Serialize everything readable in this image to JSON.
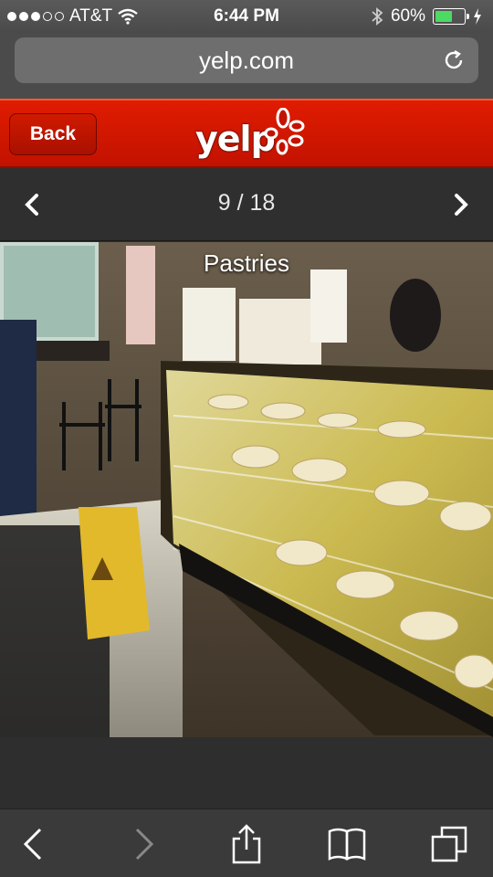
{
  "status_bar": {
    "carrier": "AT&T",
    "time": "6:44 PM",
    "battery": "60%",
    "battery_level": 0.6,
    "signal_bars": 3,
    "signal_total": 5
  },
  "browser": {
    "url": "yelp.com"
  },
  "header": {
    "back_label": "Back",
    "logo_text": "yelp"
  },
  "pager": {
    "counter": "9 / 18"
  },
  "photo": {
    "caption": "Pastries"
  },
  "colors": {
    "yelp_red": "#d01a00",
    "battery_green": "#4cd964"
  }
}
